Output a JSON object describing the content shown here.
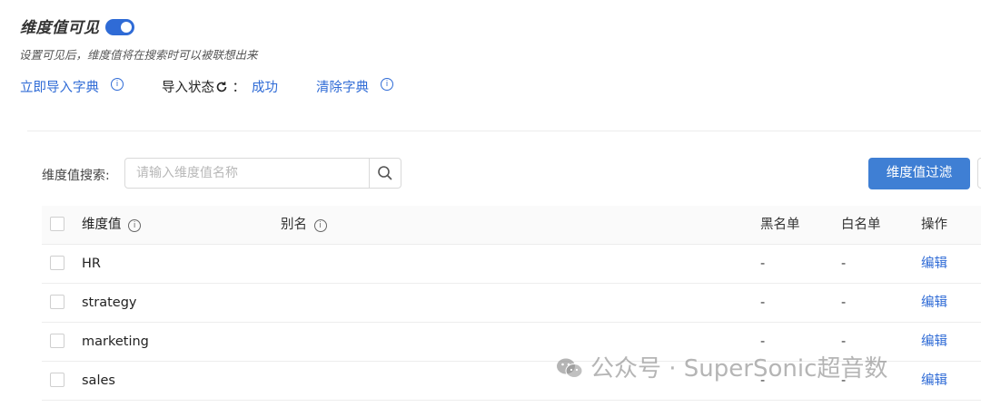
{
  "header": {
    "title": "维度值可见",
    "toggle_on": true,
    "subtitle": "设置可见后，维度值将在搜索时可以被联想出来"
  },
  "dictionary": {
    "import_label": "立即导入字典",
    "status_label": "导入状态",
    "status_separator": "：",
    "status_value": "成功",
    "clear_label": "清除字典"
  },
  "search": {
    "label": "维度值搜索:",
    "placeholder": "请输入维度值名称",
    "filter_button": "维度值过滤"
  },
  "table": {
    "columns": {
      "name": "维度值",
      "alias": "别名",
      "blacklist": "黑名单",
      "whitelist": "白名单",
      "actions": "操作"
    },
    "rows": [
      {
        "name": "HR",
        "alias": "",
        "blacklist": "-",
        "whitelist": "-",
        "action": "编辑"
      },
      {
        "name": "strategy",
        "alias": "",
        "blacklist": "-",
        "whitelist": "-",
        "action": "编辑"
      },
      {
        "name": "marketing",
        "alias": "",
        "blacklist": "-",
        "whitelist": "-",
        "action": "编辑"
      },
      {
        "name": "sales",
        "alias": "",
        "blacklist": "-",
        "whitelist": "-",
        "action": "编辑"
      }
    ]
  },
  "watermark": {
    "text": "公众号 · SuperSonic超音数"
  },
  "colors": {
    "accent": "#2f6bd6",
    "button": "#3f7fd4"
  }
}
